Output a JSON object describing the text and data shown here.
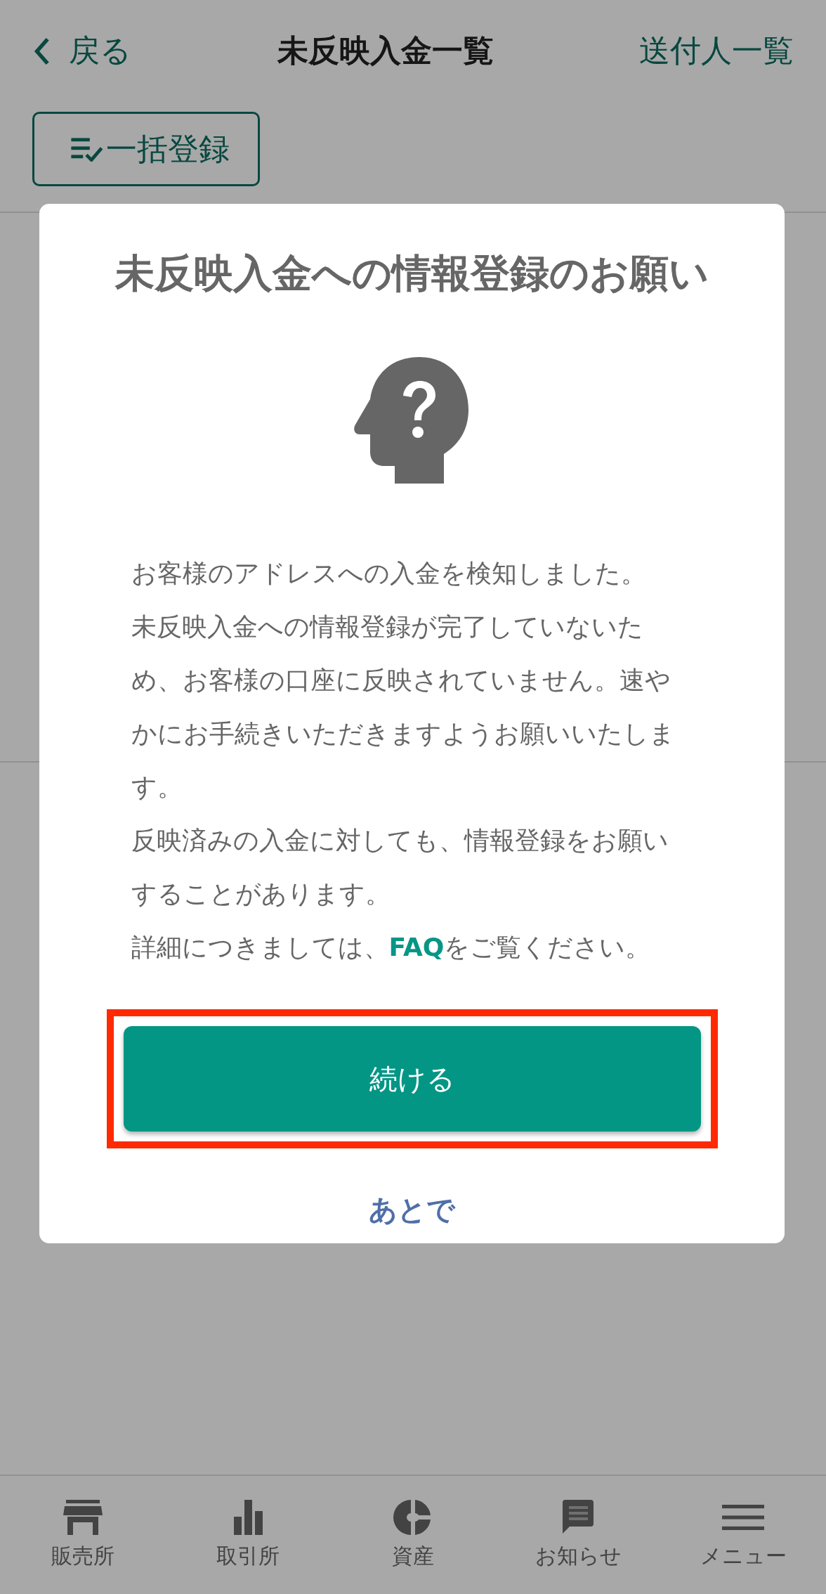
{
  "header": {
    "back_label": "戻る",
    "title": "未反映入金一覧",
    "right_link": "送付人一覧"
  },
  "toolbar": {
    "bulk_button": "一括登録"
  },
  "dialog": {
    "title": "未反映入金への情報登録のお願い",
    "paragraphs": [
      {
        "text": "お客様のアドレスへの入金を検知しました。"
      },
      {
        "text": "未反映入金への情報登録が完了していないため、お客様の口座に反映されていません。速やかにお手続きいただきますようお願いいたします。"
      },
      {
        "text": "反映済みの入金に対しても、情報登録をお願いすることがあります。"
      },
      {
        "text": "詳細につきましては、",
        "link": "FAQ",
        "after": "をご覧ください。"
      }
    ],
    "primary_button": {
      "label": "続ける",
      "highlighted": true
    },
    "secondary_link": "あとで"
  },
  "bottom_nav": [
    {
      "label": "販売所"
    },
    {
      "label": "取引所"
    },
    {
      "label": "資産"
    },
    {
      "label": "お知らせ"
    },
    {
      "label": "メニュー"
    }
  ]
}
